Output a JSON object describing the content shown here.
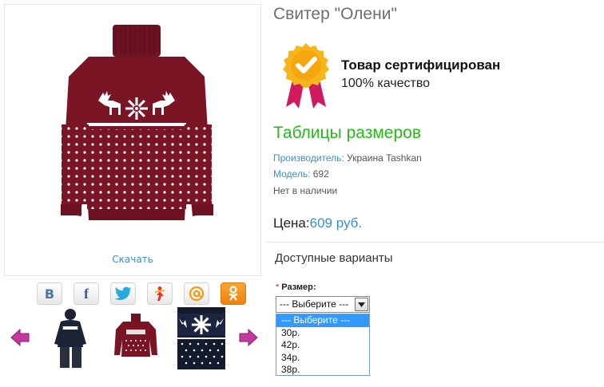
{
  "product": {
    "title": "Свитер \"Олени\"",
    "download_label": "Скачать"
  },
  "certificate": {
    "title": "Товар сертифицирован",
    "subtitle": "100% качество"
  },
  "size_table_link": "Таблицы размеров",
  "meta": {
    "manufacturer_label": "Производитель:",
    "manufacturer_value": "Украина Tashkan",
    "model_label": "Модель:",
    "model_value": "692",
    "availability": "Нет в наличии"
  },
  "price": {
    "label": "Цена:",
    "value": "609 руб."
  },
  "options": {
    "title": "Доступные варианты",
    "size_label": "Размер:",
    "required_mark": "*",
    "selected": "--- Выберите ---",
    "items": [
      "--- Выберите ---",
      "30р.",
      "42р.",
      "34р.",
      "38р."
    ]
  },
  "social": {
    "vk": "В",
    "fb": "f",
    "ok": "ок"
  },
  "colors": {
    "link": "#3b8fc4",
    "green": "#2ab61f",
    "sweater": "#7a1526",
    "highlight": "#3399ff"
  }
}
